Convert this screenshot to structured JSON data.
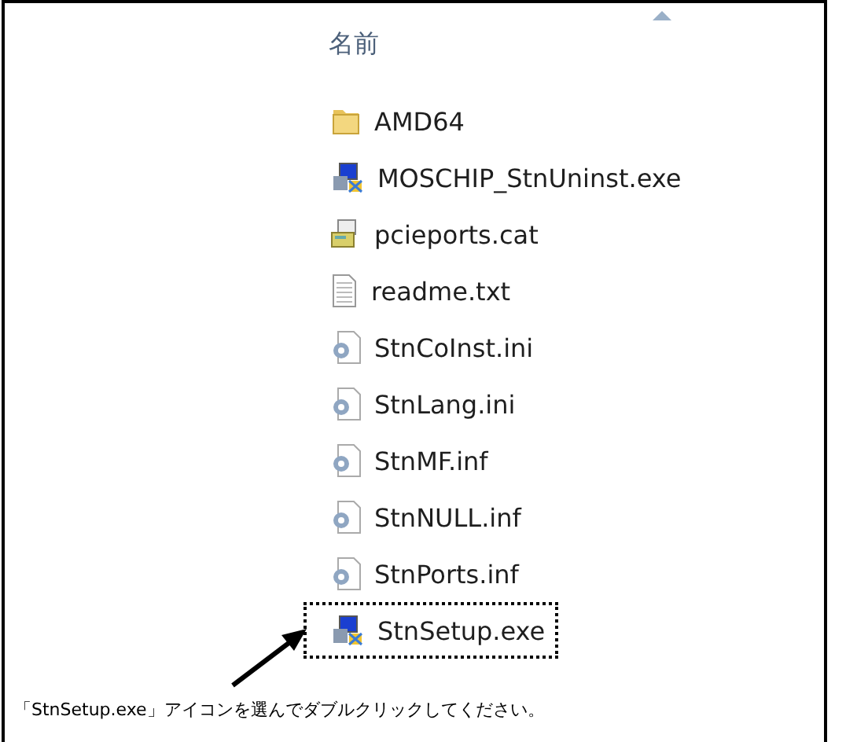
{
  "column_header": {
    "label": "名前",
    "sort_ascending": true
  },
  "files": [
    {
      "name": "AMD64",
      "kind": "folder",
      "selected": false
    },
    {
      "name": "MOSCHIP_StnUninst.exe",
      "kind": "installer",
      "selected": false
    },
    {
      "name": "pcieports.cat",
      "kind": "catalog",
      "selected": false
    },
    {
      "name": "readme.txt",
      "kind": "text",
      "selected": false
    },
    {
      "name": "StnCoInst.ini",
      "kind": "settings",
      "selected": false
    },
    {
      "name": "StnLang.ini",
      "kind": "settings",
      "selected": false
    },
    {
      "name": "StnMF.inf",
      "kind": "settings",
      "selected": false
    },
    {
      "name": "StnNULL.inf",
      "kind": "settings",
      "selected": false
    },
    {
      "name": "StnPorts.inf",
      "kind": "settings",
      "selected": false
    },
    {
      "name": "StnSetup.exe",
      "kind": "installer",
      "selected": true
    }
  ],
  "caption": "「StnSetup.exe」アイコンを選んでダブルクリックしてください。"
}
